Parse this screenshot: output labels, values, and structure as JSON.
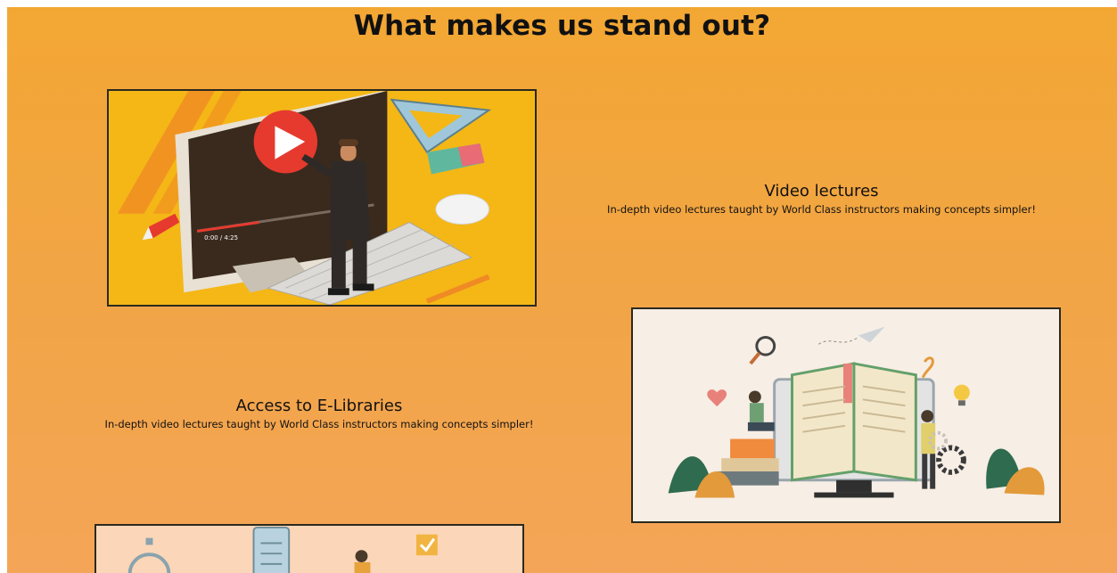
{
  "section": {
    "heading": "What makes us stand out?"
  },
  "features": [
    {
      "title": "Video lectures",
      "description": "In-depth video lectures taught by World Class instructors making concepts simpler!",
      "player_time": "0:00 / 4:25"
    },
    {
      "title": "Access to E-Libraries",
      "description": "In-depth video lectures taught by World Class instructors making concepts simpler!"
    }
  ],
  "colors": {
    "background_top": "#f3a733",
    "background_bottom": "#f4a557",
    "image_border": "#2a2a1f"
  }
}
